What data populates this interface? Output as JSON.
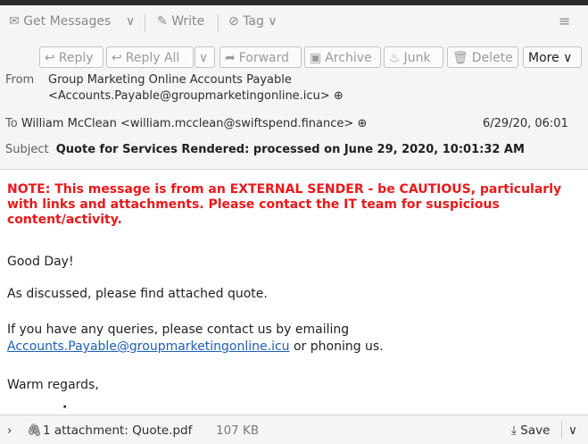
{
  "toolbar": {
    "get_messages": "Get Messages",
    "write": "Write",
    "tag": "Tag",
    "menu_icon": "≡"
  },
  "actions": {
    "reply": "Reply",
    "reply_all": "Reply All",
    "forward": "Forward",
    "archive": "Archive",
    "junk": "Junk",
    "delete": "Delete",
    "more": "More"
  },
  "header": {
    "from_label": "From",
    "from_name": "Group Marketing Online Accounts Payable",
    "from_email": "<Accounts.Payable@groupmarketingonline.icu>",
    "to_label": "To",
    "to_value": "William McClean <william.mcclean@swiftspend.finance>",
    "date": "6/29/20, 06:01",
    "subject_label": "Subject",
    "subject": "Quote for Services Rendered: processed on June 29, 2020, 10:01:32 AM"
  },
  "body": {
    "warning": "NOTE: This message is from an EXTERNAL SENDER - be CAUTIOUS, particularly with links and attachments. Please contact the IT team for suspicious content/activity.",
    "greeting": "Good Day!",
    "line1": "As discussed, please find attached quote.",
    "line2": "If you have any queries, please contact us by emailing",
    "link": "Accounts.Payable@groupmarketingonline.icu",
    "line2_tail": " or phoning us.",
    "closing": "Warm regards,"
  },
  "attachment": {
    "label": "1 attachment: Quote.pdf",
    "size": "107 KB",
    "save": "Save"
  }
}
